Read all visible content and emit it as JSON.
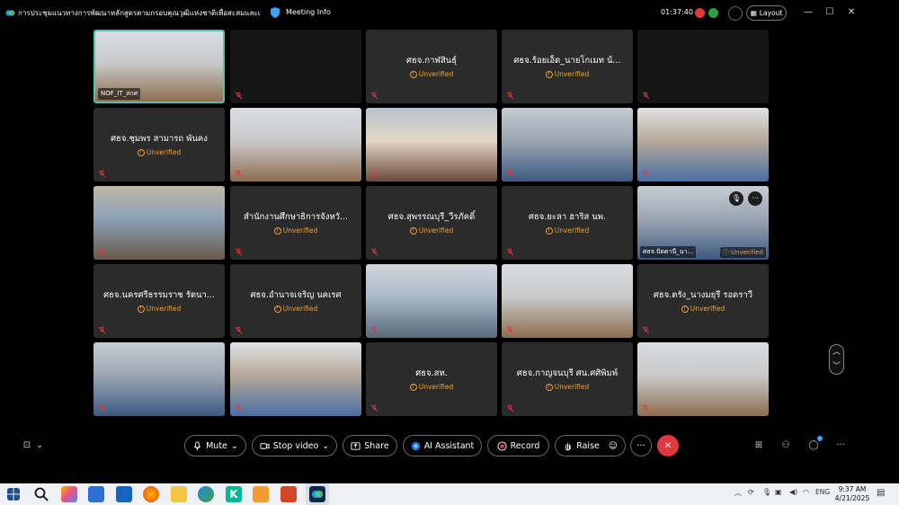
{
  "window": {
    "title": "การประชุมแนวทางการพัฒนาหลักสูตรตามกรอบคุณวุฒิแห่งชาติเพื่อสะสมและเทียบโอน...",
    "info_label": "Meeting Info",
    "timer": "01:37:40",
    "layout_label": "Layout"
  },
  "tiles": [
    {
      "name": "NOF_IT_สกศ",
      "status": "",
      "type": "video"
    },
    {
      "name": "",
      "status": "",
      "type": "dark"
    },
    {
      "name": "ศธจ.กาฬสินธุ์",
      "status": "Unverified",
      "type": "name"
    },
    {
      "name": "ศธจ.ร้อยเอ็ด_นายโกเมท น้...",
      "status": "Unverified",
      "type": "name"
    },
    {
      "name": "",
      "status": "",
      "type": "dark"
    },
    {
      "name": "ศธจ.ชุมพร สามารถ พันคง",
      "status": "Unverified",
      "type": "name"
    },
    {
      "name": "",
      "status": "",
      "type": "video"
    },
    {
      "name": "",
      "status": "",
      "type": "video"
    },
    {
      "name": "",
      "status": "",
      "type": "video"
    },
    {
      "name": "",
      "status": "",
      "type": "video"
    },
    {
      "name": "",
      "status": "",
      "type": "video"
    },
    {
      "name": "สำนักงานศึกษาธิการจังหวั...",
      "status": "Unverified",
      "type": "name"
    },
    {
      "name": "ศธจ.สุพรรณบุรี_วีรภัคดิ์",
      "status": "Unverified",
      "type": "name"
    },
    {
      "name": "ศธจ.ยะลา ฮาริส นพ.",
      "status": "Unverified",
      "type": "name"
    },
    {
      "name": "ศธจ.ปัตตานี_นา...",
      "status": "Unverified",
      "type": "video"
    },
    {
      "name": "ศธจ.นครศรีธรรมราช รัตนา...",
      "status": "Unverified",
      "type": "name"
    },
    {
      "name": "ศธจ.อำนาจเจริญ นคเรศ",
      "status": "Unverified",
      "type": "name"
    },
    {
      "name": "",
      "status": "",
      "type": "video"
    },
    {
      "name": "",
      "status": "",
      "type": "video"
    },
    {
      "name": "ศธจ.ตรัง_นางมยุรี รอดราวี",
      "status": "Unverified",
      "type": "name"
    },
    {
      "name": "",
      "status": "",
      "type": "video"
    },
    {
      "name": "",
      "status": "",
      "type": "video"
    },
    {
      "name": "ศธจ.สท.",
      "status": "Unverified",
      "type": "name"
    },
    {
      "name": "ศธจ.กาญจนบุรี ศน.ศศิพิมพ์",
      "status": "Unverified",
      "type": "name"
    },
    {
      "name": "",
      "status": "",
      "type": "video"
    }
  ],
  "controls": {
    "mute": "Mute",
    "stop_video": "Stop video",
    "share": "Share",
    "ai_assistant": "AI Assistant",
    "record": "Record",
    "raise": "Raise"
  },
  "taskbar": {
    "language": "ENG",
    "time": "9:37 AM",
    "date": "4/21/2025"
  },
  "colors": {
    "tile_bg": "#2b2b2b",
    "unverified": "#f0a030",
    "end_call": "#e0383e",
    "active_border": "#4fc3b0"
  }
}
